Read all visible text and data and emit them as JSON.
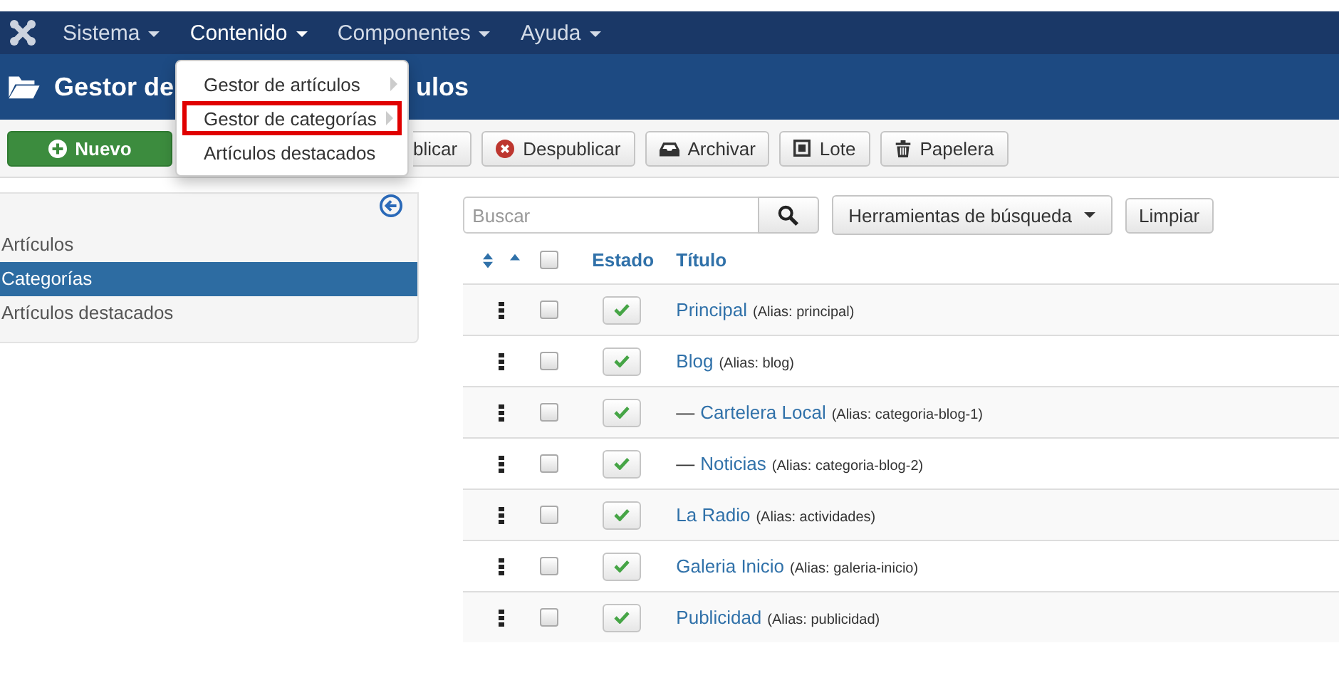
{
  "navbar": {
    "items": [
      {
        "label": "Sistema",
        "selected": false
      },
      {
        "label": "Contenido",
        "selected": true
      },
      {
        "label": "Componentes",
        "selected": false
      },
      {
        "label": "Ayuda",
        "selected": false
      }
    ]
  },
  "dropdown": {
    "items": [
      {
        "label": "Gestor de artículos",
        "highlighted": false,
        "submenu": true
      },
      {
        "label": "Gestor de categorías",
        "highlighted": true,
        "submenu": true
      },
      {
        "label": "Artículos destacados",
        "highlighted": false,
        "submenu": false
      }
    ]
  },
  "header": {
    "title_parts": [
      "Gestor de",
      "ulos"
    ]
  },
  "toolbar": {
    "buttons": [
      {
        "label": "Nuevo",
        "kind": "new"
      },
      {
        "label": "blicar",
        "kind": "partial"
      },
      {
        "label": "Despublicar",
        "kind": "unpublish"
      },
      {
        "label": "Archivar",
        "kind": "archive"
      },
      {
        "label": "Lote",
        "kind": "batch"
      },
      {
        "label": "Papelera",
        "kind": "trash"
      }
    ]
  },
  "sidebar": {
    "items": [
      {
        "label": "Artículos",
        "selected": false
      },
      {
        "label": "Categorías",
        "selected": true
      },
      {
        "label": "Artículos destacados",
        "selected": false
      }
    ]
  },
  "search": {
    "placeholder": "Buscar",
    "tools_label": "Herramientas de búsqueda",
    "clear_label": "Limpiar"
  },
  "table": {
    "select_all_checked": false,
    "columns": [
      "Estado",
      "Título"
    ],
    "rows": [
      {
        "prefix": "",
        "title": "Principal",
        "alias": "(Alias: principal)",
        "published": true,
        "checked": false
      },
      {
        "prefix": "",
        "title": "Blog",
        "alias": "(Alias: blog)",
        "published": true,
        "checked": false
      },
      {
        "prefix": "—",
        "title": "Cartelera Local",
        "alias": "(Alias: categoria-blog-1)",
        "published": true,
        "checked": false
      },
      {
        "prefix": "—",
        "title": "Noticias",
        "alias": "(Alias: categoria-blog-2)",
        "published": true,
        "checked": false
      },
      {
        "prefix": "",
        "title": "La Radio",
        "alias": "(Alias: actividades)",
        "published": true,
        "checked": false
      },
      {
        "prefix": "",
        "title": "Galeria Inicio",
        "alias": "(Alias: galeria-inicio)",
        "published": true,
        "checked": false
      },
      {
        "prefix": "",
        "title": "Publicidad",
        "alias": "(Alias: publicidad)",
        "published": true,
        "checked": false
      }
    ]
  }
}
